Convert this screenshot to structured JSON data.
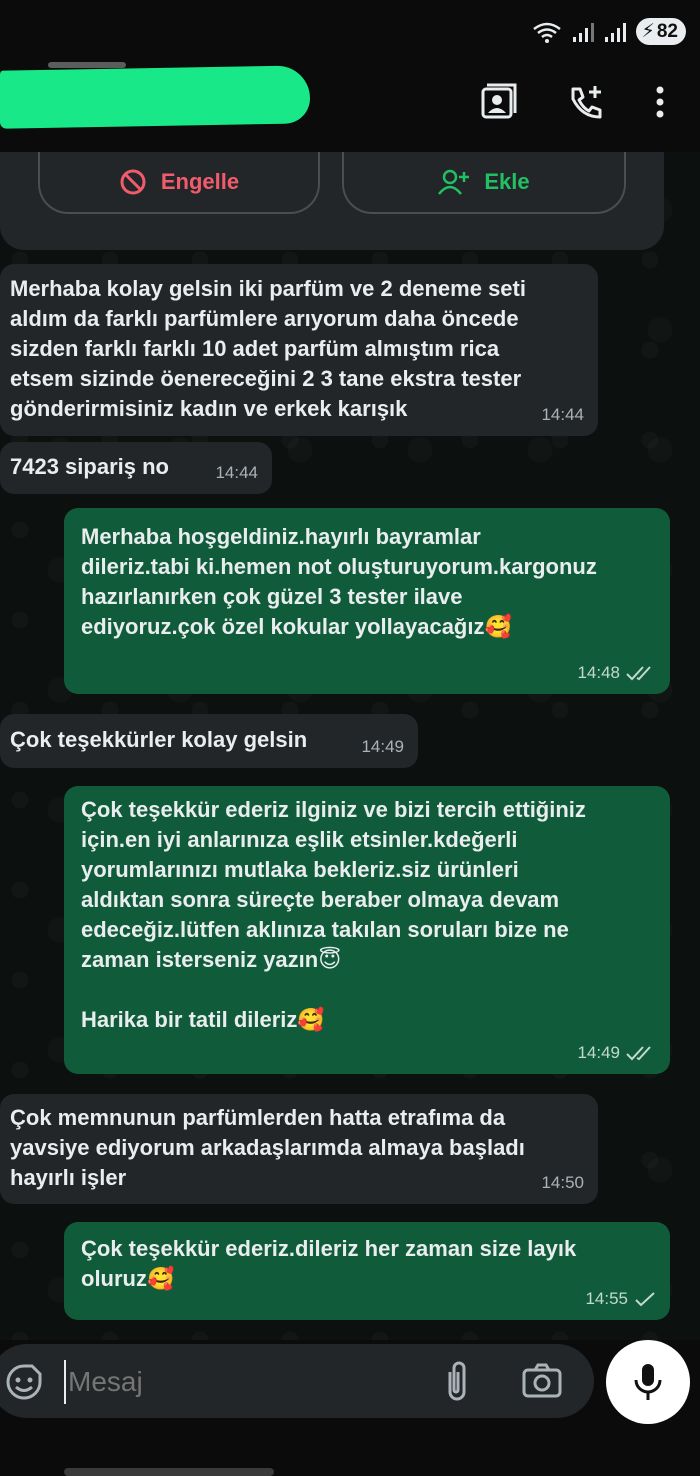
{
  "status_bar": {
    "battery": "82"
  },
  "header": {
    "contact_name": "",
    "icons": [
      "contact-card-icon",
      "add-call-icon",
      "more-vert-icon"
    ]
  },
  "actions": {
    "block_label": "Engelle",
    "add_label": "Ekle"
  },
  "messages": [
    {
      "dir": "in",
      "text": "Merhaba kolay gelsin iki parfüm ve 2 deneme seti\naldım da farklı parfümlere arıyorum daha öncede\nsizden farklı farklı 10 adet parfüm almıştım rica\netsem sizinde öenereceğini 2 3 tane ekstra tester\ngönderirmisiniz kadın ve erkek karışık",
      "time": "14:44"
    },
    {
      "dir": "in",
      "text": "7423 sipariş no",
      "time": "14:44"
    },
    {
      "dir": "out",
      "text": "Merhaba hoşgeldiniz.hayırlı bayramlar\ndileriz.tabi ki.hemen not oluşturuyorum.kargonuz\nhazırlanırken çok güzel 3 tester ilave\nediyoruz.çok özel kokular yollayacağız🥰",
      "time": "14:48",
      "status": "read"
    },
    {
      "dir": "in",
      "text": "Çok teşekkürler kolay gelsin",
      "time": "14:49"
    },
    {
      "dir": "out",
      "text": "Çok teşekkür ederiz ilginiz ve bizi tercih ettiğiniz\niçin.en iyi anlarınıza eşlik etsinler.kdeğerli\nyorumlarınızı mutlaka bekleriz.siz ürünleri\naldıktan sonra süreçte beraber olmaya devam\nedeceğiz.lütfen aklınıza takılan soruları bize ne\nzaman isterseniz yazın😇\n\nHarika bir tatil dileriz🥰",
      "time": "14:49",
      "status": "read"
    },
    {
      "dir": "in",
      "text": "Çok memnunun parfümlerden hatta etrafıma da\nyavsiye ediyorum arkadaşlarımda almaya başladı\nhayırlı işler",
      "time": "14:50"
    },
    {
      "dir": "out",
      "text": "Çok teşekkür ederiz.dileriz her zaman size layık\noluruz🥰",
      "time": "14:55",
      "status": "sent"
    }
  ],
  "composer": {
    "placeholder": "Mesaj",
    "icons": [
      "emoji-icon",
      "attach-icon",
      "camera-icon",
      "mic-icon"
    ]
  }
}
